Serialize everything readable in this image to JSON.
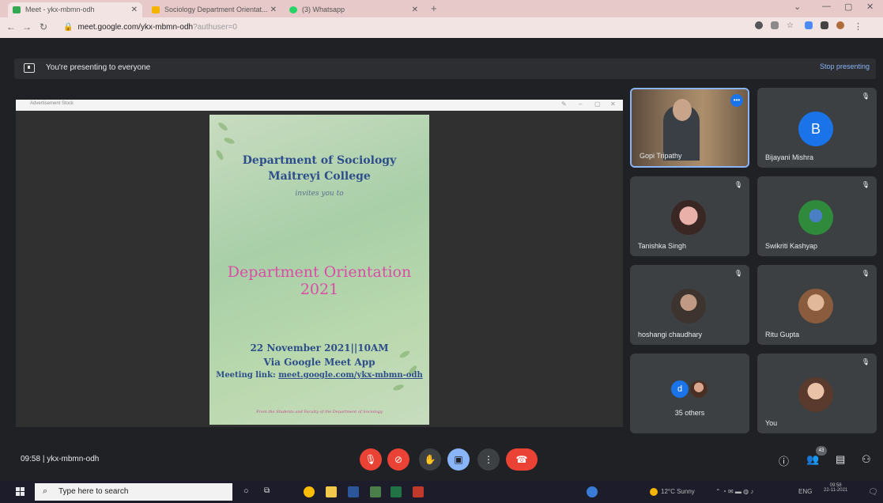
{
  "browser": {
    "tabs": [
      {
        "label": "Meet - ykx-mbmn-odh"
      },
      {
        "label": "Sociology Department Orientat..."
      },
      {
        "label": "(3) Whatsapp"
      }
    ],
    "url": "meet.google.com/ykx-mbmn-odh",
    "url_suffix": "?authuser=0"
  },
  "banner": {
    "text": "You're presenting to everyone",
    "stop_label": "Stop presenting"
  },
  "share": {
    "window_title": "Advertisement Stock"
  },
  "poster": {
    "dept": "Department of Sociology",
    "college": "Maitreyi College",
    "invites": "invites you to",
    "title": "Department Orientation 2021",
    "date": "22 November 2021||10AM",
    "via": "Via Google Meet App",
    "link_label": "Meeting link: ",
    "link": "meet.google.com/ykx-mbmn-odh",
    "from": "From the Students and Faculty of the Department of Sociology"
  },
  "participants": [
    {
      "name": "Gopi Tripathy"
    },
    {
      "name": "Bijayani Mishra",
      "initial": "B"
    },
    {
      "name": "Tanishka Singh"
    },
    {
      "name": "Swikriti Kashyap"
    },
    {
      "name": "hoshangi chaudhary"
    },
    {
      "name": "Ritu Gupta"
    },
    {
      "name": "35 others",
      "initial": "d"
    },
    {
      "name": "You"
    }
  ],
  "bottom": {
    "time": "09:58",
    "separator": "|",
    "meeting_code": "ykx-mbmn-odh",
    "people_count": "43"
  },
  "taskbar": {
    "search_placeholder": "Type here to search",
    "weather": "12°C Sunny",
    "lang": "ENG",
    "clock_time": "09:58",
    "clock_date": "22-11-2021"
  },
  "colors": {
    "meet_bg": "#202124",
    "tile_bg": "#3c4043",
    "accent_blue": "#8ab4f8",
    "end_red": "#ea4335",
    "poster_title": "#d94da6",
    "poster_heading": "#2d4e8a"
  }
}
